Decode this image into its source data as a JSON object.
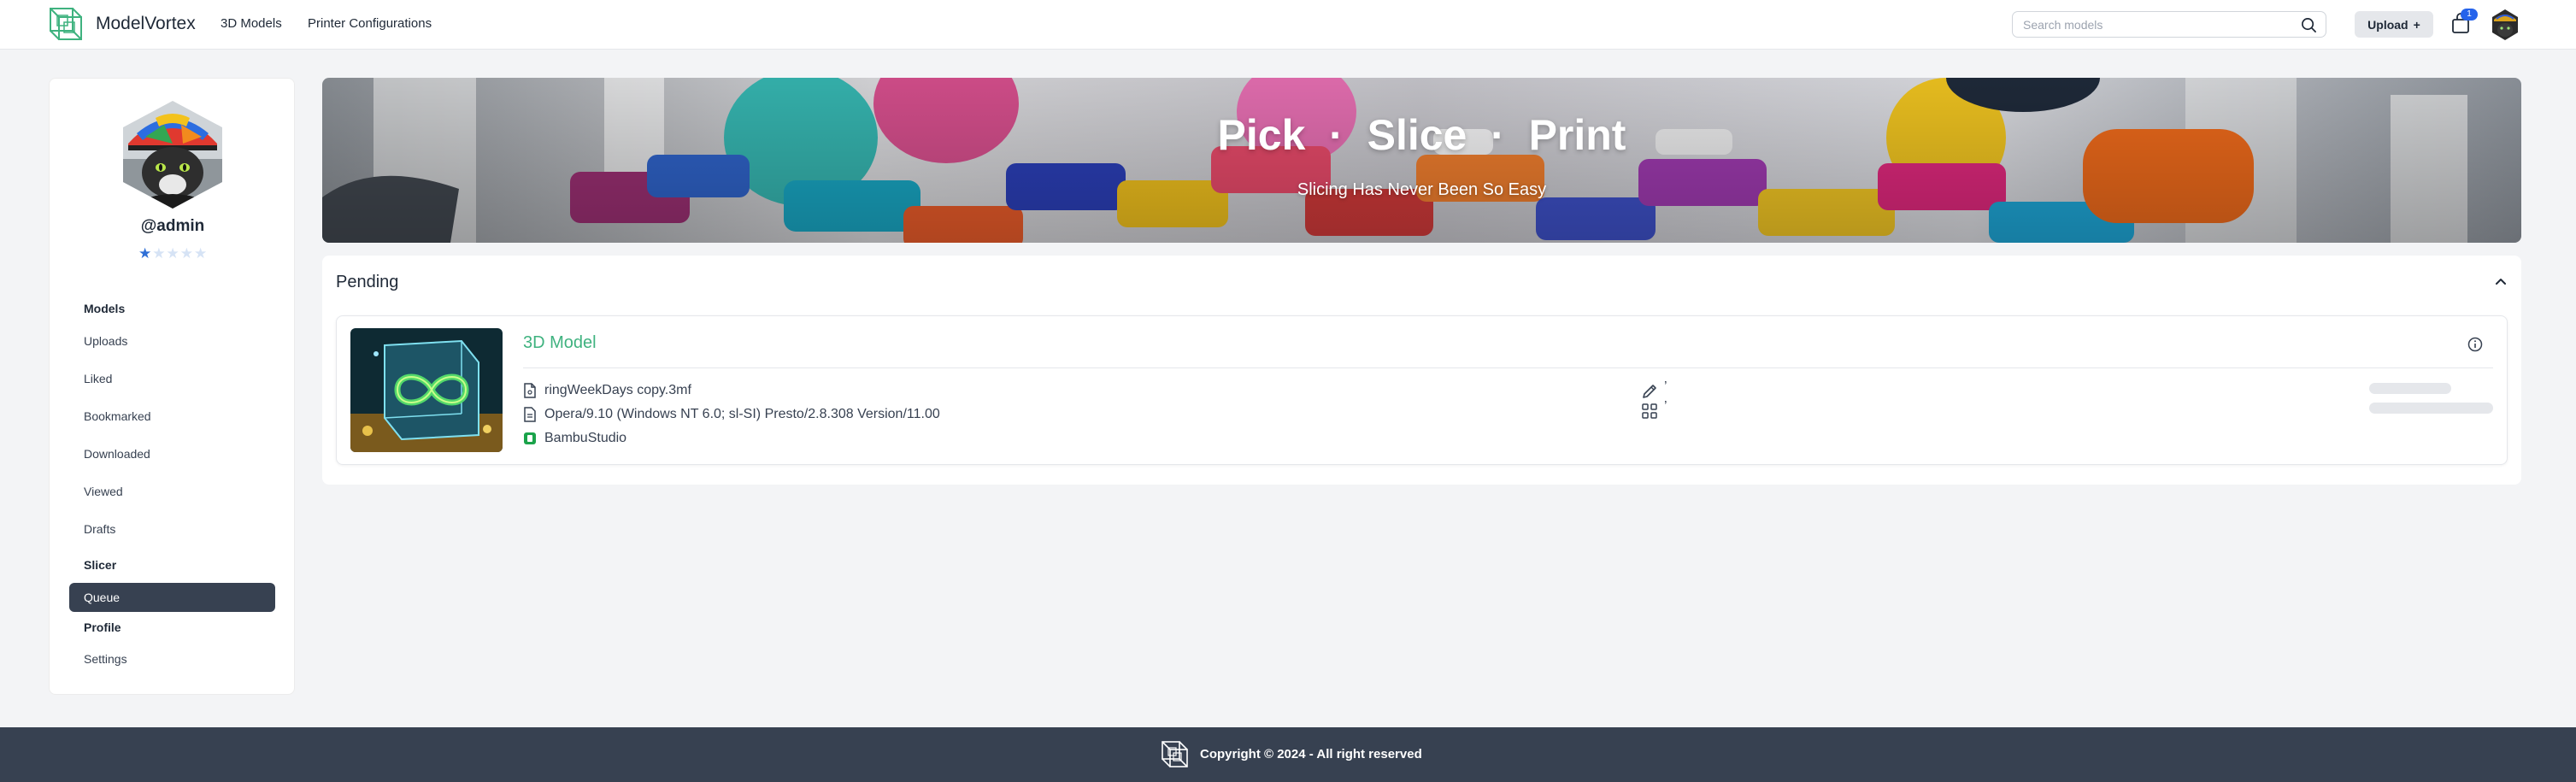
{
  "nav": {
    "brand": "ModelVortex",
    "links": [
      "3D Models",
      "Printer Configurations"
    ],
    "search_placeholder": "Search models",
    "upload_label": "Upload",
    "upload_plus": "+",
    "cart_count": "1"
  },
  "profile": {
    "username": "@admin",
    "rating": 1,
    "rating_max": 5
  },
  "sidebar": {
    "sections": [
      {
        "title": "Models",
        "items": [
          "Uploads",
          "Liked",
          "Bookmarked",
          "Downloaded",
          "Viewed",
          "Drafts"
        ]
      },
      {
        "title": "Slicer",
        "items": [
          "Queue"
        ]
      },
      {
        "title": "Profile",
        "items": [
          "Settings"
        ]
      }
    ],
    "active": "Queue"
  },
  "banner": {
    "title": "Pick  ·  Slice  ·  Print",
    "subtitle": "Slicing Has Never Been So Easy"
  },
  "pending": {
    "title": "Pending",
    "card": {
      "title": "3D Model",
      "file_name": "ringWeekDays copy.3mf",
      "user_agent": "Opera/9.10 (Windows NT 6.0; sl-SI) Presto/2.8.308 Version/11.00",
      "slicer": "BambuStudio",
      "tick_mark": "’"
    }
  },
  "footer": {
    "copyright": "Copyright © 2024 - All right reserved"
  },
  "colors": {
    "accent_green": "#3fb27f",
    "sidebar_active": "#374151",
    "footer_bg": "#374151",
    "badge_blue": "#2563eb",
    "star_blue": "#2f6fd6"
  }
}
